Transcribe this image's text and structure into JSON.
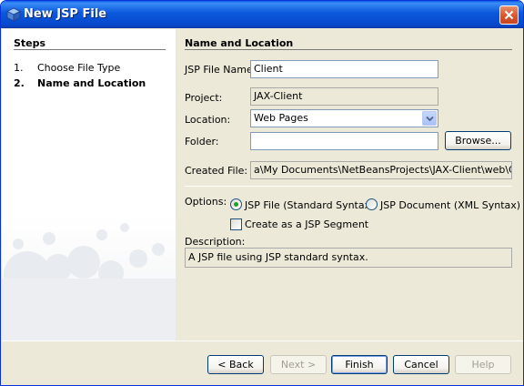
{
  "window": {
    "title": "New JSP File"
  },
  "steps": {
    "title": "Steps",
    "items": [
      {
        "number": "1.",
        "label": "Choose File Type",
        "current": false
      },
      {
        "number": "2.",
        "label": "Name and Location",
        "current": true
      }
    ]
  },
  "panel": {
    "title": "Name and Location",
    "file_name_label": "JSP File Name:",
    "file_name_value": "Client",
    "project_label": "Project:",
    "project_value": "JAX-Client",
    "location_label": "Location:",
    "location_value": "Web Pages",
    "folder_label": "Folder:",
    "folder_value": "",
    "browse_label": "Browse...",
    "created_file_label": "Created File:",
    "created_file_value": "a\\My Documents\\NetBeansProjects\\JAX-Client\\web\\Client.jsp",
    "options_label": "Options:",
    "option_jsp_file": "JSP File (Standard Syntax)",
    "option_jsp_document": "JSP Document (XML Syntax)",
    "selected_option": "JSP File (Standard Syntax)",
    "segment_label": "Create as a JSP Segment",
    "segment_checked": false,
    "description_label": "Description:",
    "description_value": "A JSP file using JSP standard syntax."
  },
  "buttons": {
    "back": "< Back",
    "next": "Next >",
    "finish": "Finish",
    "cancel": "Cancel",
    "help": "Help"
  },
  "icons": {
    "title_icon": "netbeans-cube-icon",
    "close": "close-icon",
    "dropdown": "chevron-down-icon"
  },
  "colors": {
    "titlebar": "#0c59dc",
    "close_button": "#d8562c",
    "dialog_background": "#ece9d8",
    "field_border": "#7f9db9",
    "radio_selected": "#21a121"
  }
}
